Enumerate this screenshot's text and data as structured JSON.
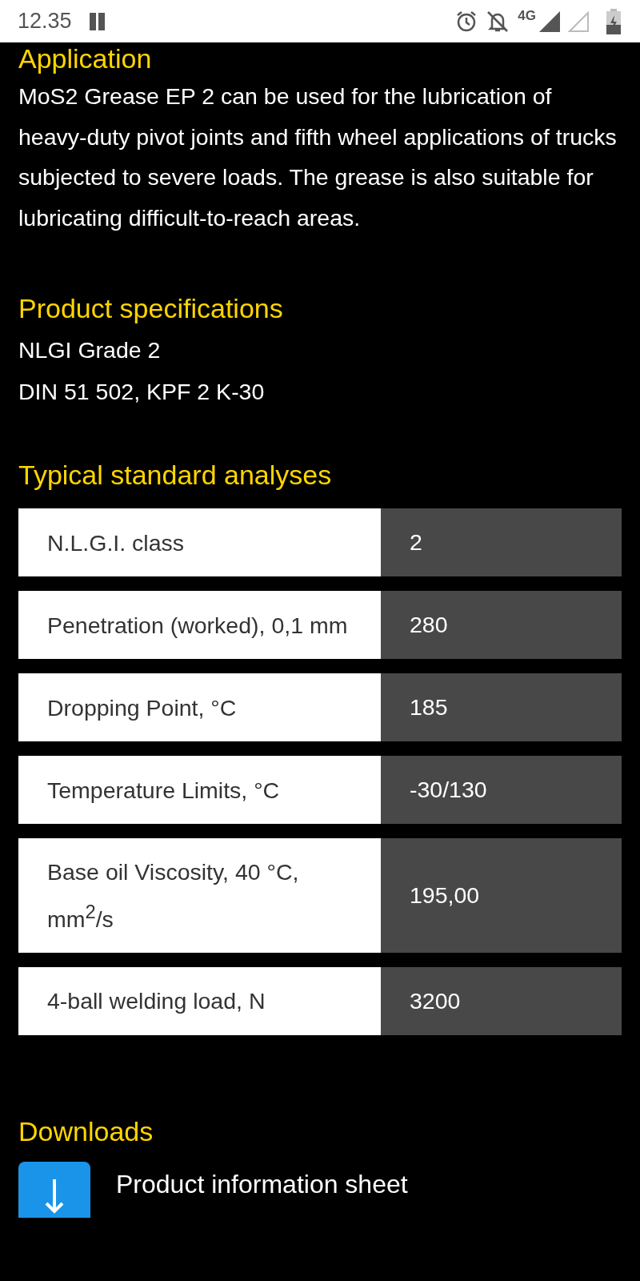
{
  "status_bar": {
    "time": "12.35",
    "network": "4G"
  },
  "application": {
    "heading": "Application",
    "text": "MoS2 Grease EP 2 can be used for the lubrication of heavy-duty pivot joints and fifth wheel applications of trucks subjected to severe loads. The grease is also suitable for lubricating difficult-to-reach areas."
  },
  "specifications": {
    "heading": "Product specifications",
    "lines": [
      "NLGI Grade 2",
      "DIN 51 502, KPF 2 K-30"
    ]
  },
  "analyses": {
    "heading": "Typical standard analyses",
    "rows": [
      {
        "label": "N.L.G.I. class",
        "value": "2"
      },
      {
        "label": "Penetration (worked), 0,1 mm",
        "value": "280"
      },
      {
        "label": "Dropping Point, °C",
        "value": "185"
      },
      {
        "label": "Temperature Limits, °C",
        "value": "-30/130"
      },
      {
        "label": "Base oil Viscosity, 40 °C, mm$^{2}$/s",
        "value": "195,00"
      },
      {
        "label": "4-ball welding load, N",
        "value": "3200"
      }
    ]
  },
  "downloads": {
    "heading": "Downloads",
    "items": [
      {
        "label": "Product information sheet"
      }
    ]
  }
}
